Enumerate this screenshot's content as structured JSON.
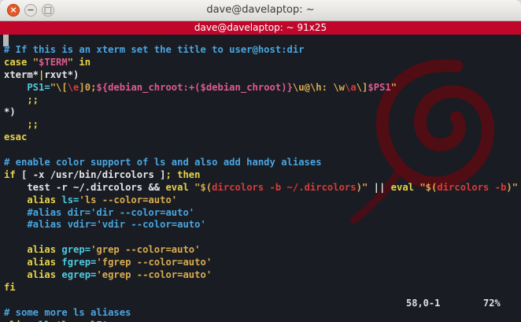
{
  "window": {
    "title": "dave@davelaptop: ~"
  },
  "tab": {
    "title": "dave@davelaptop: ~ 91x25"
  },
  "terminal": {
    "lines": [
      [
        {
          "t": "# If this is an xterm set the title to user@host:dir",
          "c": "c"
        }
      ],
      [
        {
          "t": "case ",
          "c": "k"
        },
        {
          "t": "\"",
          "c": "s"
        },
        {
          "t": "$TERM",
          "c": "v"
        },
        {
          "t": "\"",
          "c": "s"
        },
        {
          "t": " in",
          "c": "k"
        }
      ],
      [
        {
          "t": "xterm*",
          "c": "w"
        },
        {
          "t": "|",
          "c": "k"
        },
        {
          "t": "rxvt*)",
          "c": "w"
        }
      ],
      [
        {
          "t": "    PS1=",
          "c": "t"
        },
        {
          "t": "\"\\[",
          "c": "s"
        },
        {
          "t": "\\e",
          "c": "r"
        },
        {
          "t": "]0;",
          "c": "s"
        },
        {
          "t": "${debian_chroot:+(",
          "c": "v"
        },
        {
          "t": "$debian_chroot",
          "c": "v"
        },
        {
          "t": ")}",
          "c": "v"
        },
        {
          "t": "\\u",
          "c": "s"
        },
        {
          "t": "@",
          "c": "s"
        },
        {
          "t": "\\h",
          "c": "s"
        },
        {
          "t": ": ",
          "c": "s"
        },
        {
          "t": "\\w",
          "c": "s"
        },
        {
          "t": "\\a",
          "c": "r"
        },
        {
          "t": "\\]",
          "c": "s"
        },
        {
          "t": "$PS1",
          "c": "v"
        },
        {
          "t": "\"",
          "c": "s"
        }
      ],
      [
        {
          "t": "    ;;",
          "c": "k"
        }
      ],
      [
        {
          "t": "*)",
          "c": "w"
        }
      ],
      [
        {
          "t": "    ;;",
          "c": "k"
        }
      ],
      [
        {
          "t": "esac",
          "c": "k"
        }
      ],
      [
        {
          "t": "",
          "c": "w"
        }
      ],
      [
        {
          "t": "# enable color support of ls and also add handy aliases",
          "c": "c"
        }
      ],
      [
        {
          "t": "if ",
          "c": "k"
        },
        {
          "t": "[ -x /usr/bin/dircolors ]",
          "c": "w"
        },
        {
          "t": "; then",
          "c": "k"
        }
      ],
      [
        {
          "t": "    test -r ~/.dircolors ",
          "c": "w"
        },
        {
          "t": "&&",
          "c": "w"
        },
        {
          "t": " eval ",
          "c": "k"
        },
        {
          "t": "\"$(",
          "c": "s"
        },
        {
          "t": "dircolors -b ~/.dircolors",
          "c": "r"
        },
        {
          "t": ")\"",
          "c": "s"
        },
        {
          "t": " || ",
          "c": "w"
        },
        {
          "t": "eval ",
          "c": "k"
        },
        {
          "t": "\"$(",
          "c": "s"
        },
        {
          "t": "dircolors -b",
          "c": "r"
        },
        {
          "t": ")\"",
          "c": "s"
        }
      ],
      [
        {
          "t": "    alias ",
          "c": "k"
        },
        {
          "t": "ls=",
          "c": "t"
        },
        {
          "t": "'ls --color=auto'",
          "c": "s"
        }
      ],
      [
        {
          "t": "    #alias dir='dir --color=auto'",
          "c": "c"
        }
      ],
      [
        {
          "t": "    #alias vdir='vdir --color=auto'",
          "c": "c"
        }
      ],
      [
        {
          "t": "",
          "c": "w"
        }
      ],
      [
        {
          "t": "    alias ",
          "c": "k"
        },
        {
          "t": "grep=",
          "c": "t"
        },
        {
          "t": "'grep --color=auto'",
          "c": "s"
        }
      ],
      [
        {
          "t": "    alias ",
          "c": "k"
        },
        {
          "t": "fgrep=",
          "c": "t"
        },
        {
          "t": "'fgrep --color=auto'",
          "c": "s"
        }
      ],
      [
        {
          "t": "    alias ",
          "c": "k"
        },
        {
          "t": "egrep=",
          "c": "t"
        },
        {
          "t": "'egrep --color=auto'",
          "c": "s"
        }
      ],
      [
        {
          "t": "fi",
          "c": "k"
        }
      ],
      [
        {
          "t": "",
          "c": "w"
        }
      ],
      [
        {
          "t": "# some more ls aliases",
          "c": "c"
        }
      ],
      [
        {
          "t": "alias ",
          "c": "k"
        },
        {
          "t": "ll=",
          "c": "t"
        },
        {
          "t": "'ls -alF'",
          "c": "s"
        }
      ]
    ],
    "status": {
      "position": "58,0-1",
      "percent": "72%"
    }
  },
  "colors": {
    "tab_bar": "#c0062b",
    "background": "#191c22",
    "swirl": "#5a0a12"
  },
  "icons": {
    "close": "×",
    "minimize": "−",
    "maximize": "□"
  }
}
